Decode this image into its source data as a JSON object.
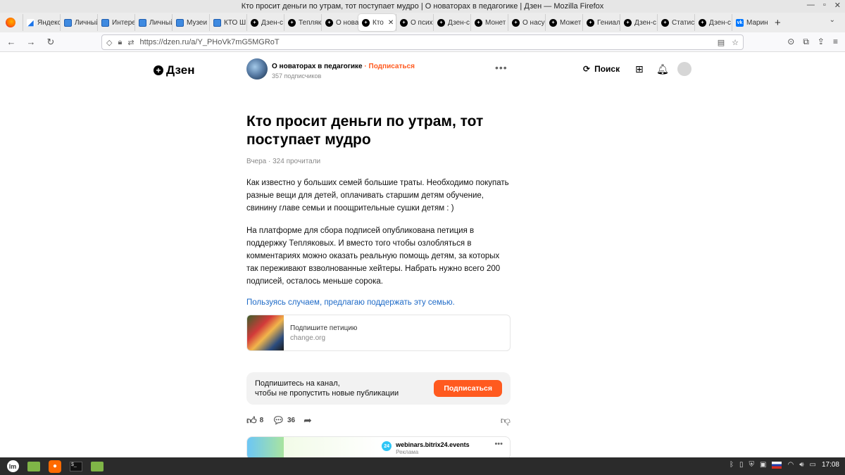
{
  "window": {
    "title": "Кто просит деньги по утрам, тот поступает мудро | О новаторах в педагогике | Дзен — Mozilla Firefox",
    "controls": [
      "—",
      "▫",
      "✕"
    ]
  },
  "tabs": [
    {
      "label": "Яндекс",
      "icon": "y"
    },
    {
      "label": "Личный",
      "icon": "b"
    },
    {
      "label": "Интерес",
      "icon": "b"
    },
    {
      "label": "Личный",
      "icon": "b"
    },
    {
      "label": "Музеи",
      "icon": "b"
    },
    {
      "label": "КТО Ш",
      "icon": "b"
    },
    {
      "label": "Дзен-с",
      "icon": "d"
    },
    {
      "label": "Тепляк",
      "icon": "d"
    },
    {
      "label": "О нова",
      "icon": "d"
    },
    {
      "label": "Кто",
      "icon": "d",
      "active": true
    },
    {
      "label": "О псих",
      "icon": "d"
    },
    {
      "label": "Дзен-с",
      "icon": "d"
    },
    {
      "label": "Монет",
      "icon": "d"
    },
    {
      "label": "О насу",
      "icon": "d"
    },
    {
      "label": "Может",
      "icon": "d"
    },
    {
      "label": "Гениал",
      "icon": "d"
    },
    {
      "label": "Дзен-с",
      "icon": "d"
    },
    {
      "label": "Статис",
      "icon": "d"
    },
    {
      "label": "Дзен-с",
      "icon": "d"
    },
    {
      "label": "Марин",
      "icon": "vk"
    }
  ],
  "tab_close": "✕",
  "new_tab": "+",
  "tab_list": "⌄",
  "url": "https://dzen.ru/a/Y_PHoVk7mG5MGRoT",
  "site": {
    "logo_text": "Дзен",
    "logo_mark": "+",
    "channel_name": "О новаторах в педагогике",
    "subscribe_link": " · Подписаться",
    "subscribers": "357 подписчиков",
    "more": "•••",
    "search_label": "Поиск"
  },
  "article": {
    "title": "Кто просит деньги по утрам, тот поступает мудро",
    "meta": "Вчера · 324 прочитали",
    "p1": "Как известно у больших семей большие траты. Необходимо покупать разные вещи для детей, оплачивать старшим детям обучение, свинину главе семьи и поощрительные сушки детям : )",
    "p2": "На платформе для сбора подписей опубликована петиция в поддержку Тепляковых. И вместо того чтобы озлобляться в комментариях можно оказать реальную помощь детям, за которых так переживают взволнованные хейтеры. Набрать нужно всего 200 подписей, осталось меньше сорока.",
    "link_text": "Пользуясь случаем, предлагаю поддержать эту семью.",
    "card_title": "Подпишите петицию",
    "card_url": "change.org"
  },
  "subscribe_box": {
    "line1": "Подпишитесь на канал,",
    "line2": "чтобы не пропустить новые публикации",
    "button": "Подписаться"
  },
  "reactions": {
    "likes": "8",
    "comments": "36"
  },
  "ad": {
    "logo": "24",
    "name": "webinars.bitrix24.events",
    "label": "Реклама",
    "more": "•••"
  },
  "taskbar": {
    "mint": "lm",
    "terminal": "$_",
    "clock": "17:08"
  }
}
